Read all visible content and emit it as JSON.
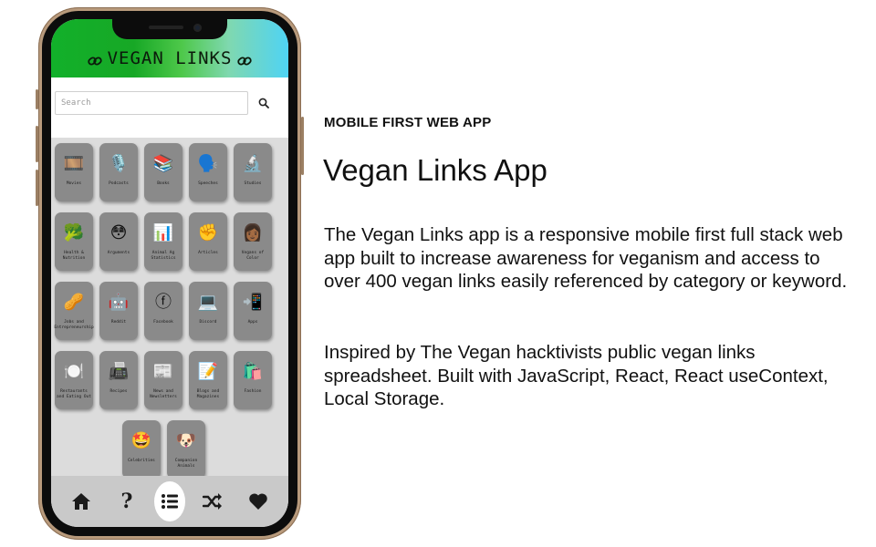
{
  "app": {
    "title": "VEGAN LINKS",
    "search_placeholder": "Search",
    "accent_colors": {
      "header_start": "#12b02a",
      "header_end": "#4fd3f4",
      "tile": "#8a8a8a",
      "nav": "#c9c9c9"
    }
  },
  "categories": [
    {
      "label": "Movies",
      "emoji": "🎞️"
    },
    {
      "label": "Podcasts",
      "emoji": "🎙️"
    },
    {
      "label": "Books",
      "emoji": "📚"
    },
    {
      "label": "Speeches",
      "emoji": "🗣️"
    },
    {
      "label": "Studies",
      "emoji": "🔬"
    },
    {
      "label": "Health & Nutrition",
      "emoji": "🥦"
    },
    {
      "label": "Arguments",
      "emoji": "😳"
    },
    {
      "label": "Animal Ag Statistics",
      "emoji": "📊"
    },
    {
      "label": "Articles",
      "emoji": "✊"
    },
    {
      "label": "Vegans of Color",
      "emoji": "👩🏾"
    },
    {
      "label": "Jobs and Entrepreneurship",
      "emoji": "🥜"
    },
    {
      "label": "Reddit",
      "emoji": "🤖"
    },
    {
      "label": "Facebook",
      "emoji": "ⓕ"
    },
    {
      "label": "Discord",
      "emoji": "💻"
    },
    {
      "label": "Apps",
      "emoji": "📲"
    },
    {
      "label": "Restaurants and Eating Out",
      "emoji": "🍽️"
    },
    {
      "label": "Recipes",
      "emoji": "📠"
    },
    {
      "label": "News and Newsletters",
      "emoji": "📰"
    },
    {
      "label": "Blogs and Magazines",
      "emoji": "📝"
    },
    {
      "label": "Fashion",
      "emoji": "🛍️"
    },
    {
      "label": "Celebrities",
      "emoji": "🤩"
    },
    {
      "label": "Companion Animals",
      "emoji": "🐶"
    }
  ],
  "nav": [
    {
      "name": "home-icon"
    },
    {
      "name": "help-icon",
      "text": "?"
    },
    {
      "name": "list-icon"
    },
    {
      "name": "shuffle-icon"
    },
    {
      "name": "heart-icon"
    }
  ],
  "content": {
    "eyebrow": "MOBILE FIRST WEB APP",
    "title": "Vegan Links App",
    "paragraph1": "The Vegan Links app is a responsive mobile first full stack web app built to increase awareness for veganism and access to over 400 vegan links easily referenced by category or keyword.",
    "paragraph2": "Inspired by The Vegan hacktivists public vegan links spreadsheet. Built with JavaScript, React, React useContext, Local Storage."
  }
}
